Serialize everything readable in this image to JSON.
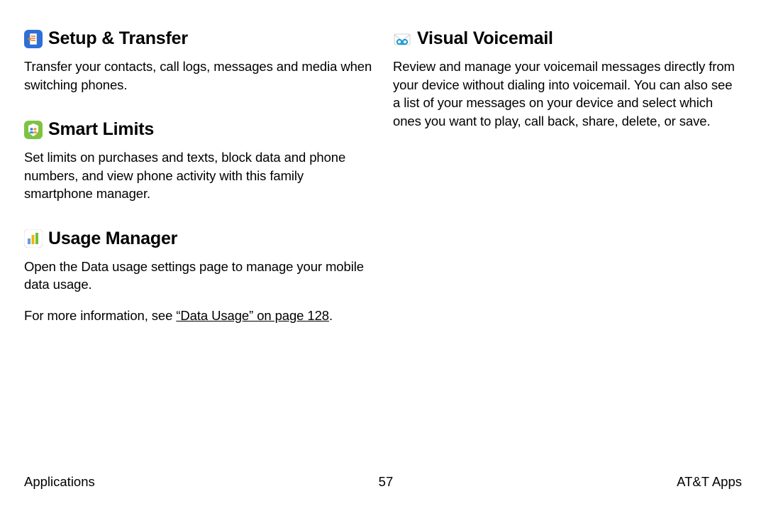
{
  "left": {
    "setup_transfer": {
      "title": "Setup & Transfer",
      "body": "Transfer your contacts, call logs, messages and media when switching phones."
    },
    "smart_limits": {
      "title": "Smart Limits",
      "body": "Set limits on purchases and texts, block data and phone numbers, and view phone activity with this family smartphone manager."
    },
    "usage_manager": {
      "title": "Usage Manager",
      "body1": "Open the Data usage settings page to manage your mobile data usage.",
      "body2_prefix": "For more information, see ",
      "body2_link": "“Data Usage” on page 128",
      "body2_suffix": "."
    }
  },
  "right": {
    "visual_voicemail": {
      "title": "Visual Voicemail",
      "body": "Review and manage your voicemail messages directly from your device without dialing into voicemail. You can also see a list of your messages on your device and select which ones you want to play, call back, share, delete, or save."
    }
  },
  "footer": {
    "left": "Applications",
    "center": "57",
    "right": "AT&T Apps"
  }
}
